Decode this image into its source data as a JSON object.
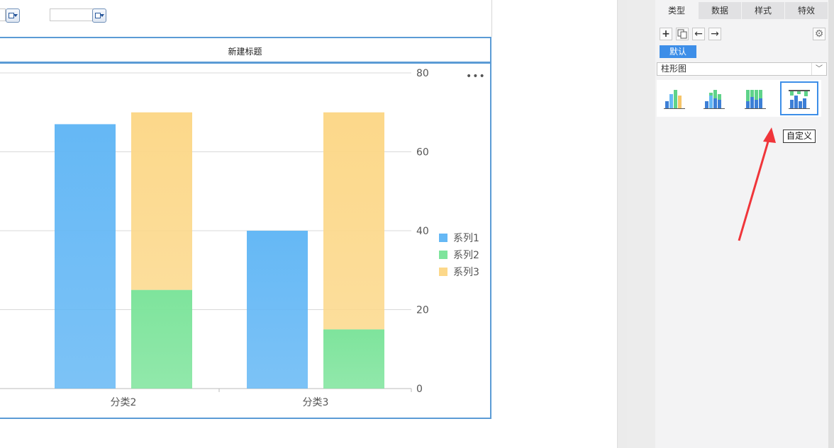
{
  "widget_title": "新建标题",
  "more_icon": "more-horizontal-icon",
  "chart_data": {
    "type": "bar",
    "categories": [
      "分类2",
      "分类3"
    ],
    "series": [
      {
        "name": "系列1",
        "values": [
          67,
          40
        ],
        "color": "#65b8f5",
        "stack": "a"
      },
      {
        "name": "系列2",
        "values": [
          25,
          15
        ],
        "color": "#7ee49c",
        "stack": "b"
      },
      {
        "name": "系列3",
        "values": [
          45,
          55
        ],
        "color": "#fcd88a",
        "stack": "b"
      }
    ],
    "y_axis": {
      "position": "right",
      "min": 0,
      "max": 80,
      "ticks": [
        0,
        20,
        40,
        60,
        80
      ]
    },
    "grid": true,
    "legend": "right"
  },
  "panel": {
    "tabs": [
      {
        "label": "类型",
        "active": true
      },
      {
        "label": "数据",
        "active": false
      },
      {
        "label": "样式",
        "active": false
      },
      {
        "label": "特效",
        "active": false
      }
    ],
    "tools": [
      "add-icon",
      "copy-icon",
      "arrow-left-icon",
      "arrow-right-icon"
    ],
    "settings_icon": "gear-icon",
    "default_tag": "默认",
    "chart_type_select": {
      "value": "柱形图"
    },
    "thumbnails": [
      {
        "name": "clustered-bar-thumb",
        "selected": false
      },
      {
        "name": "stacked-bar-thumb",
        "selected": false
      },
      {
        "name": "percent-stacked-bar-thumb",
        "selected": false
      },
      {
        "name": "custom-bar-thumb",
        "selected": true
      }
    ],
    "tooltip": "自定义"
  },
  "colors": {
    "accent": "#3d8ee8",
    "chart_border": "#5b9bd5",
    "annotation_arrow": "#f0353a"
  }
}
